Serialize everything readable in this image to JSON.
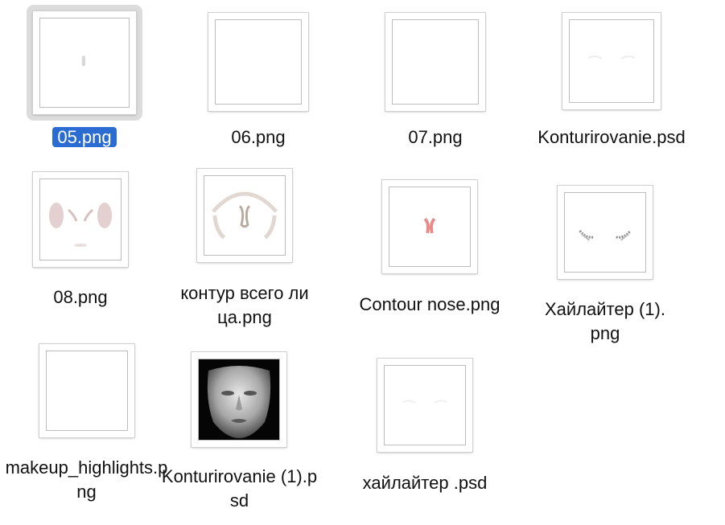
{
  "files": [
    {
      "name": "05.png",
      "selected": true,
      "preview": "faint-dot"
    },
    {
      "name": "06.png",
      "selected": false,
      "preview": "blank"
    },
    {
      "name": "07.png",
      "selected": false,
      "preview": "blank"
    },
    {
      "name": "Konturirovanie.psd",
      "selected": false,
      "preview": "faint-brows"
    },
    {
      "name": "08.png",
      "selected": false,
      "preview": "blush-contour"
    },
    {
      "name": "контур всего лица.png",
      "selected": false,
      "preview": "face-contour"
    },
    {
      "name": "Contour nose.png",
      "selected": false,
      "preview": "nose-contour"
    },
    {
      "name": "Хайлайтер (1).png",
      "selected": false,
      "preview": "highlighter-strokes"
    },
    {
      "name": "makeup_highlights.png",
      "selected": false,
      "preview": "blank"
    },
    {
      "name": "Konturirovanie (1).psd",
      "selected": false,
      "preview": "face-3d-dark"
    },
    {
      "name": "хайлайтер .psd",
      "selected": false,
      "preview": "faint-brows"
    }
  ],
  "colors": {
    "selection": "#2a6cd1",
    "selection_bg": "#dcdcdc"
  }
}
